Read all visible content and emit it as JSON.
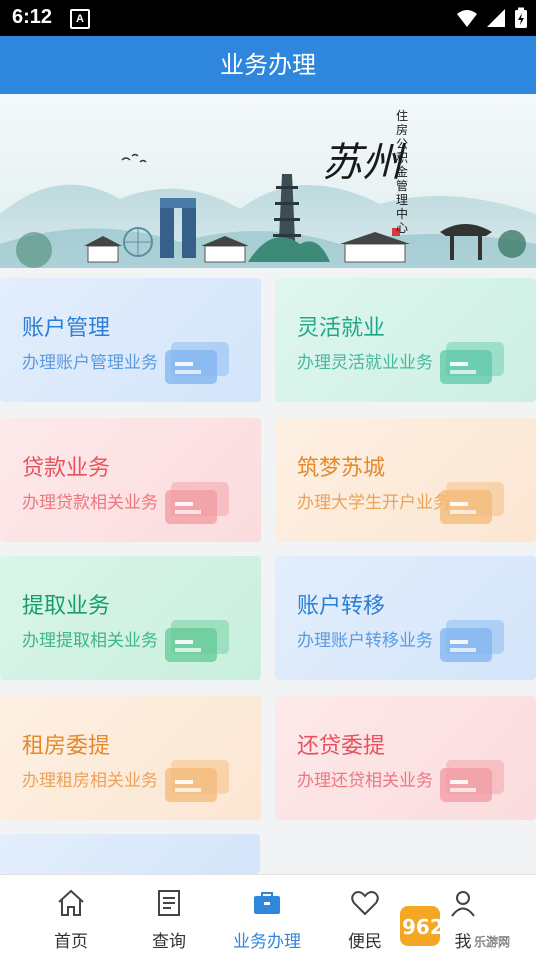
{
  "status": {
    "time": "6:12",
    "notif_glyph": "A"
  },
  "header": {
    "title": "业务办理"
  },
  "banner": {
    "city": "苏州",
    "org": "住房公积金管理中心"
  },
  "cards": [
    {
      "title": "账户管理",
      "subtitle": "办理账户管理业务",
      "title_color": "#2b7fd6",
      "sub_color": "#5a9be0"
    },
    {
      "title": "灵活就业",
      "subtitle": "办理灵活就业业务",
      "title_color": "#1ea789",
      "sub_color": "#48b79d"
    },
    {
      "title": "贷款业务",
      "subtitle": "办理贷款相关业务",
      "title_color": "#e8525f",
      "sub_color": "#ec7780"
    },
    {
      "title": "筑梦苏城",
      "subtitle": "办理大学生开户业务",
      "title_color": "#e58a2a",
      "sub_color": "#eba25a"
    },
    {
      "title": "提取业务",
      "subtitle": "办理提取相关业务",
      "title_color": "#17a066",
      "sub_color": "#3fb783"
    },
    {
      "title": "账户转移",
      "subtitle": "办理账户转移业务",
      "title_color": "#2b7fd6",
      "sub_color": "#5a9be0"
    },
    {
      "title": "租房委提",
      "subtitle": "办理租房相关业务",
      "title_color": "#e58a2a",
      "sub_color": "#eba25a"
    },
    {
      "title": "还贷委提",
      "subtitle": "办理还贷相关业务",
      "title_color": "#e8525f",
      "sub_color": "#ec7780"
    }
  ],
  "tabs": [
    {
      "label": "首页",
      "icon": "home-icon"
    },
    {
      "label": "查询",
      "icon": "document-icon"
    },
    {
      "label": "业务办理",
      "icon": "briefcase-icon"
    },
    {
      "label": "便民",
      "icon": "heart-icon"
    },
    {
      "label": "我",
      "icon": "user-icon"
    }
  ],
  "watermark": {
    "brand": "962.NET",
    "sub": "乐游网"
  }
}
